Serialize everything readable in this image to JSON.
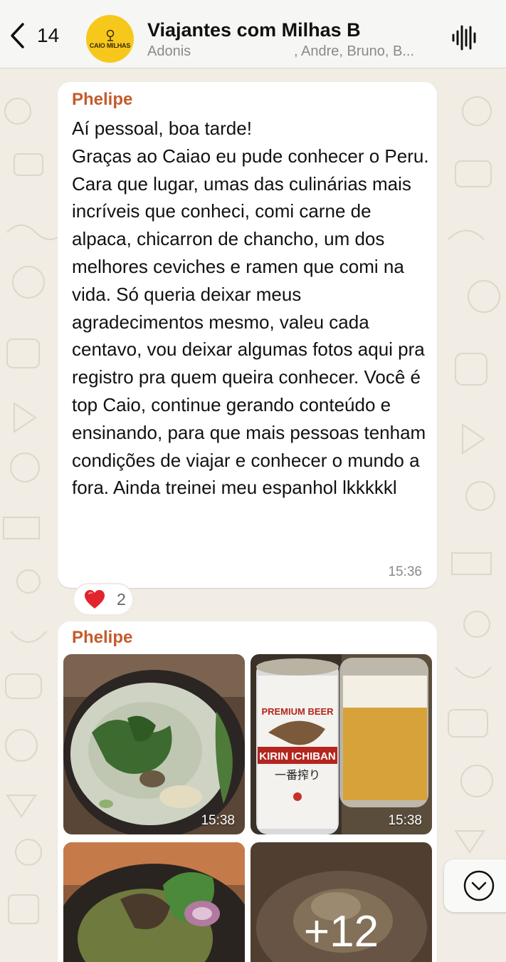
{
  "header": {
    "back_count": "14",
    "avatar_text": "CAIO MILHAS",
    "title": "Viajantes com Milhas B",
    "subtitle_first": "Adonis",
    "subtitle_rest": ", Andre, Bruno, B..."
  },
  "messages": [
    {
      "sender": "Phelipe",
      "text": "Aí pessoal, boa tarde!\nGraças ao Caiao eu pude conhecer o Peru. Cara que lugar, umas das culinárias mais incríveis que conheci, comi carne de alpaca, chicarron de chancho, um dos melhores ceviches e ramen que comi na vida. Só queria deixar meus agradecimentos mesmo, valeu cada centavo, vou deixar algumas fotos aqui pra registro pra quem queira conhecer. Você é top Caio, continue gerando conteúdo e ensinando, para que mais pessoas tenham condições de viajar e conhecer o mundo a fora. Ainda treinei meu espanhol lkkkkkl",
      "time": "15:36",
      "reaction": {
        "emoji": "heart",
        "count": "2"
      }
    },
    {
      "sender": "Phelipe",
      "photos": [
        {
          "desc": "soup-photo",
          "time": "15:38"
        },
        {
          "desc": "beer-photo",
          "time": "15:38"
        },
        {
          "desc": "dish-photo"
        },
        {
          "desc": "more-photos",
          "more_label": "+12"
        }
      ]
    }
  ],
  "colors": {
    "sender": "#c55b2b",
    "header_bg": "#f6f6f4",
    "wallpaper": "#efeae2",
    "avatar": "#f7c81c"
  }
}
